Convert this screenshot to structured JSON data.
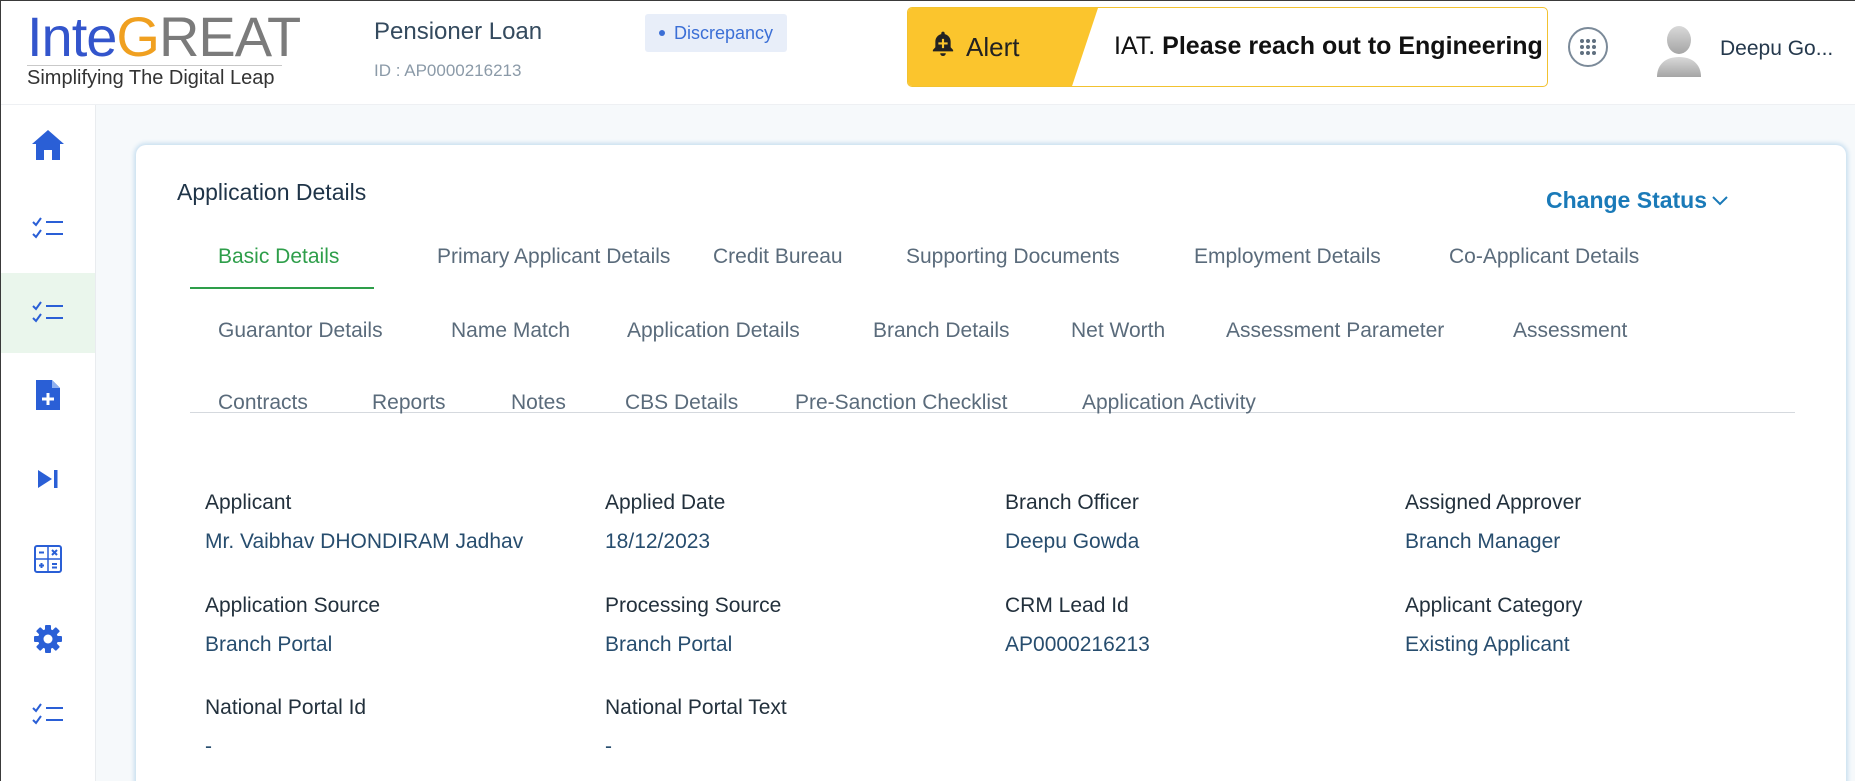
{
  "brand": {
    "logo_part1": "Inte",
    "logo_part2": "G",
    "logo_part3": "REAT",
    "tagline": "Simplifying The Digital Leap"
  },
  "product": {
    "name": "Pensioner Loan",
    "id_text": "ID : AP0000216213"
  },
  "status_badge": "Discrepancy",
  "alert": {
    "label": "Alert",
    "text_prefix": "IAT.",
    "text_main": " Please reach out to Engineering Te"
  },
  "user": {
    "name": "Deepu Go..."
  },
  "sidebar": {
    "items": [
      {
        "icon": "home-icon"
      },
      {
        "icon": "checklist-icon"
      },
      {
        "icon": "checklist-icon",
        "active": true
      },
      {
        "icon": "add-document-icon"
      },
      {
        "icon": "skip-next-icon"
      },
      {
        "icon": "calculator-icon"
      },
      {
        "icon": "gear-icon"
      },
      {
        "icon": "checklist-icon"
      }
    ]
  },
  "card": {
    "title": "Application Details",
    "change_status": "Change Status"
  },
  "tabs": [
    {
      "label": "Basic Details",
      "active": true
    },
    {
      "label": "Primary Applicant Details"
    },
    {
      "label": "Credit Bureau"
    },
    {
      "label": "Supporting Documents"
    },
    {
      "label": "Employment Details"
    },
    {
      "label": "Co-Applicant Details"
    },
    {
      "label": "Guarantor Details"
    },
    {
      "label": "Name Match"
    },
    {
      "label": "Application Details"
    },
    {
      "label": "Branch Details"
    },
    {
      "label": "Net Worth"
    },
    {
      "label": "Assessment Parameter"
    },
    {
      "label": "Assessment"
    },
    {
      "label": "Contracts"
    },
    {
      "label": "Reports"
    },
    {
      "label": "Notes"
    },
    {
      "label": "CBS Details"
    },
    {
      "label": "Pre-Sanction Checklist"
    },
    {
      "label": "Application Activity"
    }
  ],
  "fields": [
    {
      "label": "Applicant",
      "value": "Mr. Vaibhav DHONDIRAM Jadhav"
    },
    {
      "label": "Applied Date",
      "value": "18/12/2023"
    },
    {
      "label": "Branch Officer",
      "value": "Deepu Gowda"
    },
    {
      "label": "Assigned Approver",
      "value": "Branch Manager"
    },
    {
      "label": "Application Source",
      "value": "Branch Portal"
    },
    {
      "label": "Processing Source",
      "value": "Branch Portal"
    },
    {
      "label": "CRM Lead Id",
      "value": "AP0000216213"
    },
    {
      "label": "Applicant Category",
      "value": "Existing Applicant"
    },
    {
      "label": "National Portal Id",
      "value": "-"
    },
    {
      "label": "National Portal Text",
      "value": "-"
    }
  ],
  "colors": {
    "accent_blue": "#3355cc",
    "accent_green": "#2e9e4a",
    "alert_yellow": "#fbc52d",
    "link_blue": "#1a7ab8"
  }
}
